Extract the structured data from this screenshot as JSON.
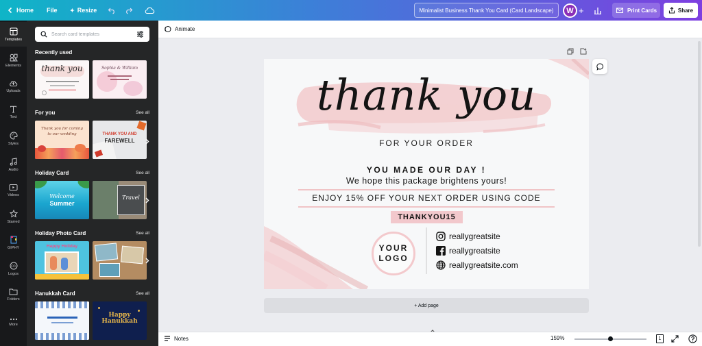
{
  "topbar": {
    "home_label": "Home",
    "file_label": "File",
    "resize_label": "Resize",
    "document_title": "Minimalist Business Thank You Card (Card Landscape)",
    "avatar_initial": "W",
    "print_label": "Print Cards",
    "share_label": "Share"
  },
  "rail": {
    "items": [
      {
        "label": "Templates",
        "icon": "templates-icon"
      },
      {
        "label": "Elements",
        "icon": "elements-icon"
      },
      {
        "label": "Uploads",
        "icon": "uploads-icon"
      },
      {
        "label": "Text",
        "icon": "text-icon"
      },
      {
        "label": "Styles",
        "icon": "styles-icon"
      },
      {
        "label": "Audio",
        "icon": "audio-icon"
      },
      {
        "label": "Videos",
        "icon": "videos-icon"
      },
      {
        "label": "Starred",
        "icon": "star-icon"
      },
      {
        "label": "GIPHY",
        "icon": "giphy-icon"
      },
      {
        "label": "Logos",
        "icon": "logos-icon"
      },
      {
        "label": "Folders",
        "icon": "folder-icon"
      },
      {
        "label": "More",
        "icon": "more-icon"
      }
    ]
  },
  "panel": {
    "search_placeholder": "Search card templates",
    "sections": [
      {
        "title": "Recently used",
        "see_all": ""
      },
      {
        "title": "For you",
        "see_all": "See all"
      },
      {
        "title": "Holiday Card",
        "see_all": "See all"
      },
      {
        "title": "Holiday Photo Card",
        "see_all": "See all"
      },
      {
        "title": "Hanukkah Card",
        "see_all": "See all"
      }
    ],
    "thumb_text": {
      "t1": "thank you",
      "t2": "Sophia & William",
      "t3": "Thank you for coming to our wedding",
      "t4a": "THANK YOU AND",
      "t4b": "FAREWELL",
      "t5a": "Welcome",
      "t5b": "Summer",
      "t6": "Travel",
      "t7": "Happy Holiday",
      "t9a": "Happy",
      "t9b": "Hanukkah"
    }
  },
  "toolbar": {
    "animate_label": "Animate"
  },
  "card": {
    "script_title": "thank you",
    "for_order": "FOR YOUR ORDER",
    "made_day": "YOU MADE OUR DAY !",
    "hope": "We hope this package brightens yours!",
    "offer": "ENJOY 15% OFF YOUR NEXT ORDER USING CODE",
    "code": "THANKYOU15",
    "logo_line1": "YOUR",
    "logo_line2": "LOGO",
    "instagram": "reallygreatsite",
    "facebook": "reallygreatsite",
    "website": "reallygreatsite.com"
  },
  "add_page_label": "+ Add page",
  "bottombar": {
    "notes_label": "Notes",
    "zoom": "159%",
    "zoom_fraction": 0.5,
    "page_number": "1"
  },
  "colors": {
    "brand_gradient_start": "#0fb5c7",
    "brand_gradient_end": "#7d3fe0",
    "pink": "#f1c4c6",
    "code_bg": "#f2c8cc",
    "avatar": "#8b2fb8"
  }
}
